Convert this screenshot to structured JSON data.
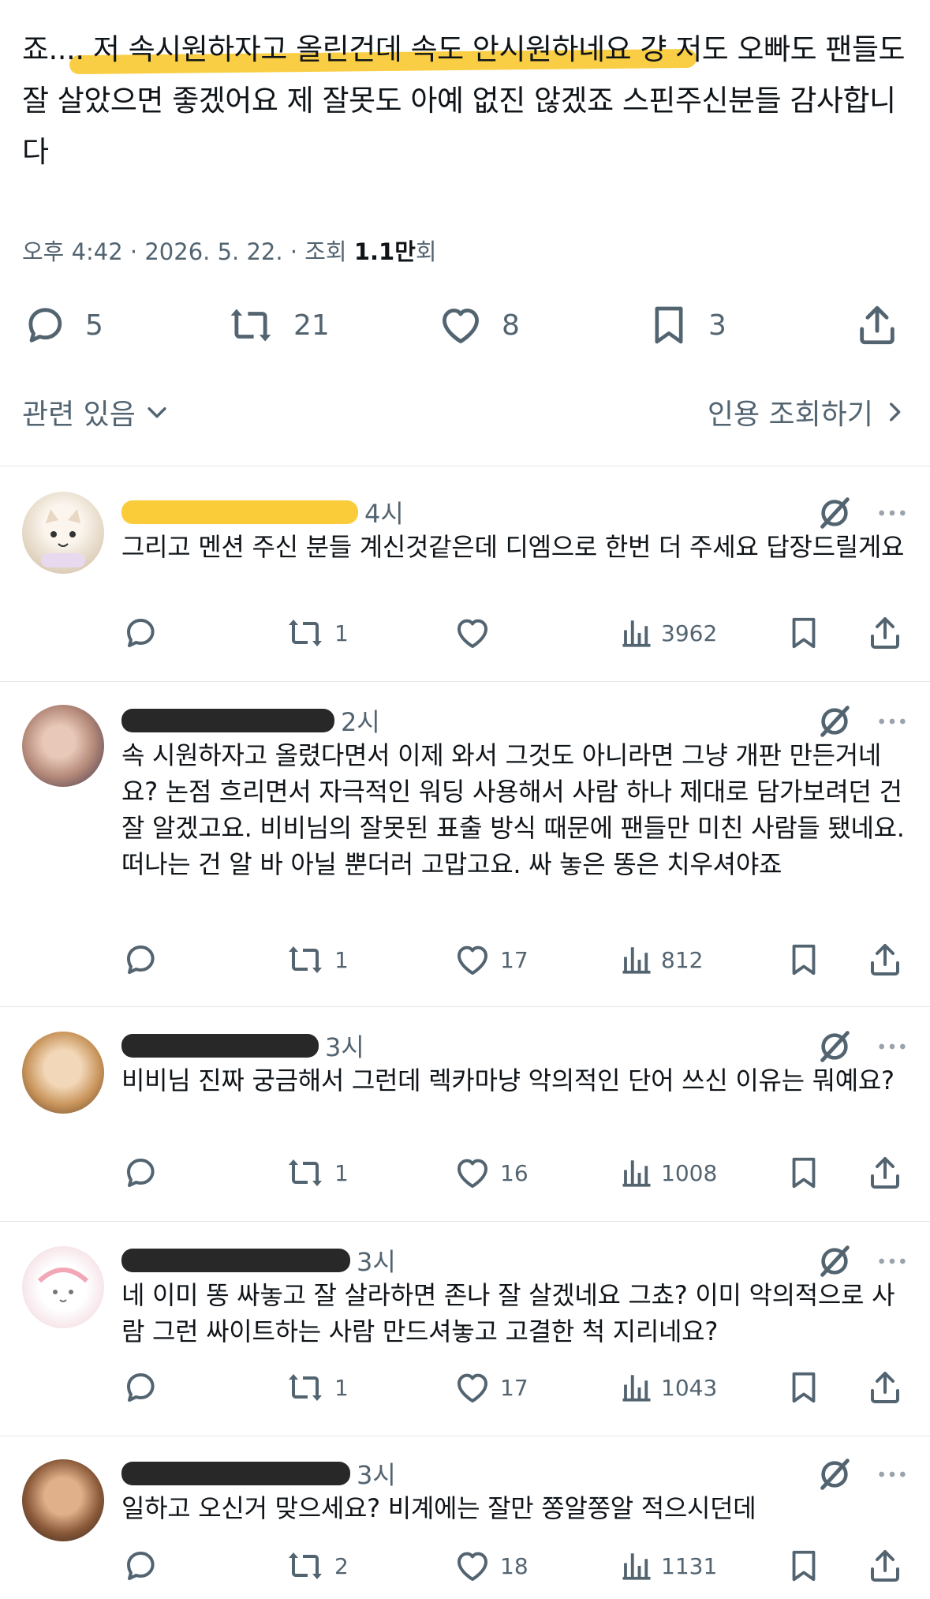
{
  "post": {
    "text": "죠.... 저 속시원하자고 올린건데 속도 안시원하네요 걍 저도 오빠도 팬들도 잘 살았으면 좋겠어요 제 잘못도 아예 없진 않겠죠 스핀주신분들 감사합니다",
    "meta_time": "오후 4:42 · 2026. 5. 22. · 조회 ",
    "views_bold": "1.1만",
    "views_suffix": "회",
    "counts": {
      "replies": "5",
      "reposts": "21",
      "likes": "8",
      "bookmarks": "3"
    }
  },
  "links": {
    "related": "관련 있음",
    "quote": "인용 조회하기"
  },
  "icons": [
    "reply-icon",
    "repost-icon",
    "like-icon",
    "bookmark-icon",
    "share-icon",
    "views-icon",
    "grok-icon",
    "more-icon",
    "chevron-down-icon",
    "chevron-right-icon"
  ],
  "colors": {
    "text": "#0f1419",
    "muted": "#536471",
    "highlight": "#f9c623",
    "divider": "#e4e8ea"
  },
  "replies": [
    {
      "time": "4시",
      "text": "그리고 멘션 주신 분들 계신것같은데 디엠으로 한번 더 주세요 답장드릴게요",
      "reposts": "1",
      "likes": "",
      "views": "3962"
    },
    {
      "time": "2시",
      "text": "속 시원하자고 올렸다면서 이제 와서 그것도 아니라면 그냥 개판 만든거네요? 논점 흐리면서 자극적인 워딩 사용해서 사람 하나 제대로 담가보려던 건 잘 알겠고요. 비비님의 잘못된 표출 방식 때문에 팬들만 미친 사람들 됐네요. 떠나는 건 알 바 아닐 뿐더러 고맙고요. 싸 놓은 똥은 치우셔야죠",
      "reposts": "1",
      "likes": "17",
      "views": "812"
    },
    {
      "time": "3시",
      "text": "비비님 진짜 궁금해서 그런데 렉카마냥 악의적인 단어 쓰신 이유는 뭐예요?",
      "reposts": "1",
      "likes": "16",
      "views": "1008"
    },
    {
      "time": "3시",
      "text": "네 이미 똥 싸놓고 잘 살라하면 존나 잘 살겠네요 그쵸? 이미 악의적으로 사람 그런 싸이트하는 사람 만드셔놓고 고결한 척 지리네요?",
      "reposts": "1",
      "likes": "17",
      "views": "1043"
    },
    {
      "time": "3시",
      "text": "일하고 오신거 맞으세요? 비계에는 잘만 쫑알쫑알 적으시던데",
      "reposts": "2",
      "likes": "18",
      "views": "1131"
    }
  ]
}
